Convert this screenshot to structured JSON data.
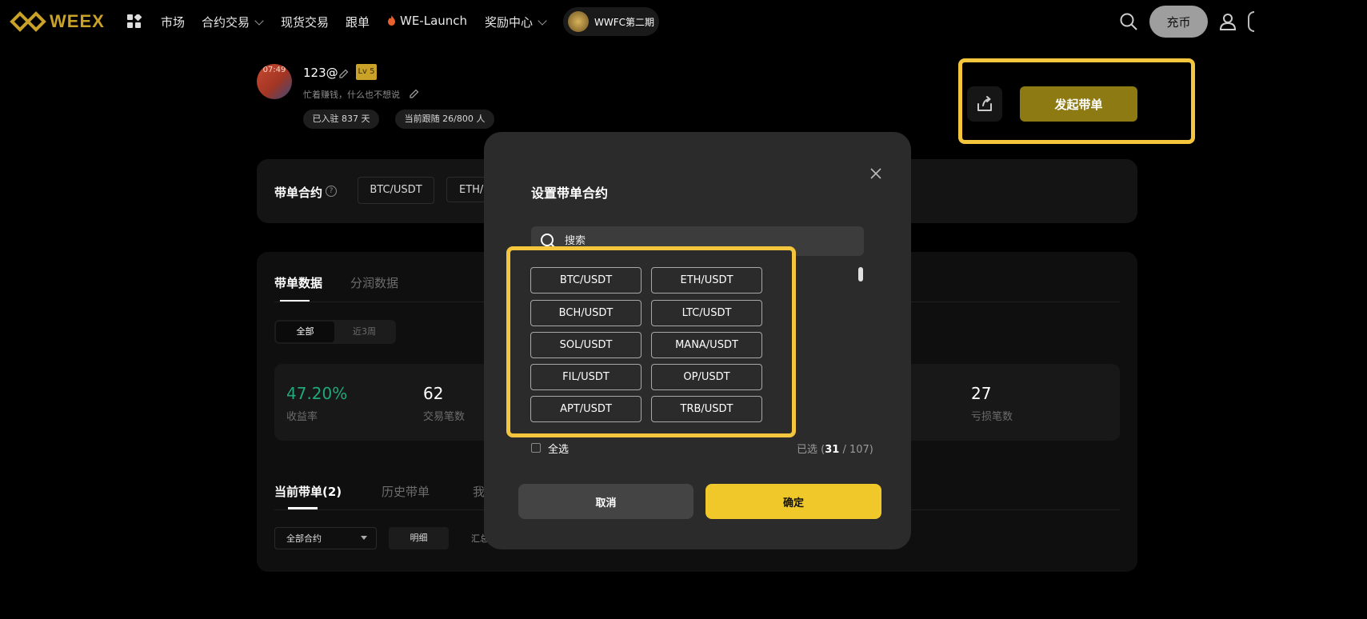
{
  "nav": {
    "logo_text": "WEEX",
    "items": {
      "market": "市场",
      "futures": "合约交易",
      "spot": "现货交易",
      "copy": "跟单",
      "launch": "WE-Launch",
      "rewards": "奖励中心",
      "wwfc": "WWFC第二期"
    },
    "deposit_label": "充币",
    "brand_color": "#c9a227"
  },
  "profile": {
    "avatar_time": "07:49",
    "username": "123@",
    "level": "Lv 5",
    "bio": "忙着赚钱，什么也不想说",
    "days_chip": "已入驻 837 天",
    "followers_chip": "当前跟随 26/800 人",
    "start_button": "发起带单"
  },
  "contracts_card": {
    "title": "带单合约",
    "pairs": [
      "BTC/USDT",
      "ETH/U"
    ]
  },
  "data_card": {
    "tabs": [
      "带单数据",
      "分润数据"
    ],
    "segments": [
      "全部",
      "近3周"
    ],
    "stats": [
      {
        "value": "47.20%",
        "label": "收益率"
      },
      {
        "value": "62",
        "label": "交易笔数"
      },
      {
        "value": "27",
        "label": "亏损笔数"
      }
    ],
    "positive_color": "#1fa97a",
    "bottom_tabs": [
      "当前带单(2)",
      "历史带单",
      "我"
    ],
    "contract_select": "全部合约",
    "detail_button": "明细",
    "summary_label": "汇总"
  },
  "modal": {
    "title": "设置带单合约",
    "search_placeholder": "搜索",
    "pairs": [
      "BTC/USDT",
      "ETH/USDT",
      "BCH/USDT",
      "LTC/USDT",
      "SOL/USDT",
      "MANA/USDT",
      "FIL/USDT",
      "OP/USDT",
      "APT/USDT",
      "TRB/USDT"
    ],
    "select_all": "全选",
    "selected_prefix": "已选 (",
    "selected_count": "31",
    "selected_total": " / 107)",
    "cancel": "取消",
    "confirm": "确定",
    "highlight_color": "#f4c63d"
  }
}
